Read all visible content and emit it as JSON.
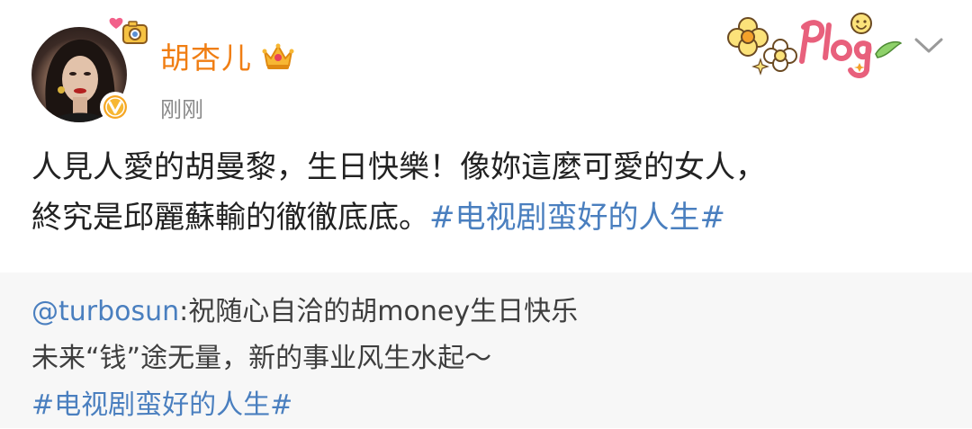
{
  "post": {
    "author": {
      "name": "胡杏儿",
      "avatar_icon": "avatar-photo",
      "badge_icon": "crown-vip-icon",
      "verified_icon": "verified-v-badge-icon"
    },
    "timestamp": "刚刚",
    "sticker": "plog-sticker",
    "menu_icon": "chevron-down-icon",
    "text": {
      "line1": "人見人愛的胡曼黎，生日快樂！像妳這麼可愛的女人，",
      "line2_text": "終究是邱麗蘇輸的徹徹底底。",
      "line2_hashtag": "#电视剧蛮好的人生#"
    }
  },
  "repost": {
    "mention": "@turbosun",
    "line1_text": ":祝随心自洽的胡money生日快乐",
    "line2": "未来“钱”途无量，新的事业风生水起～",
    "line3_hashtag": "#电视剧蛮好的人生#"
  },
  "colors": {
    "username": "#f07e13",
    "link": "#4a7fbf",
    "body_text": "#222222",
    "meta_text": "#8a8a8a",
    "repost_bg": "#f7f7f7"
  }
}
